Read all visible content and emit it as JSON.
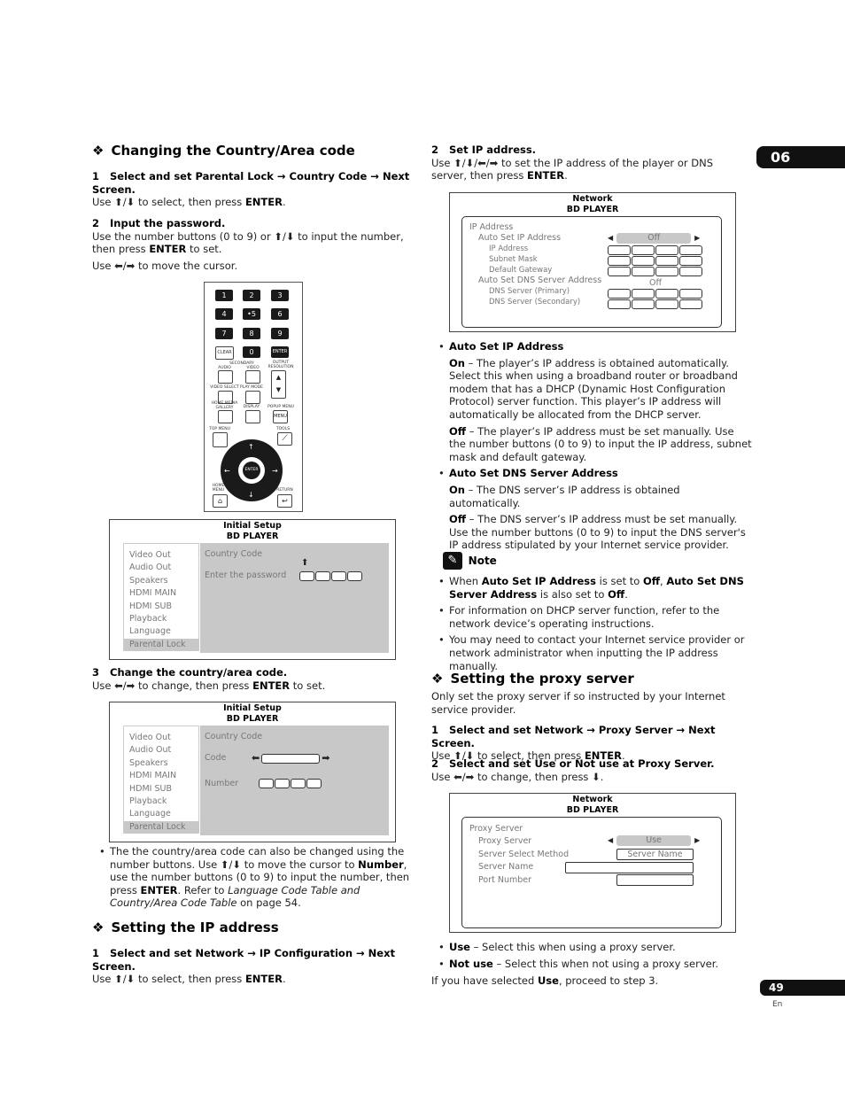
{
  "chapter_tab": "06",
  "page_number": "49",
  "page_lang": "En",
  "left": {
    "country_title": "Changing the Country/Area code",
    "step1_num": "1",
    "step1_title": "Select and set Parental Lock → Country Code → Next Screen.",
    "step1_text_a": "Use ⬆/⬇ to select, then press ",
    "step1_text_b": "ENTER",
    "step2_num": "2",
    "step2_title": "Input the password.",
    "step2_text_a": "Use the number buttons (0 to 9) or ⬆/⬇ to input the number, then press ",
    "step2_text_b": "ENTER",
    " step2_text_c": " to set.",
    "step2_text_d": "Use ⬅/➡ to move the cursor.",
    "step3_num": "3",
    "step3_title": "Change the country/area code.",
    "step3_text_a": "Use ⬅/➡ to change, then press ",
    "step3_text_b": "ENTER",
    "step3_text_c": " to set.",
    "bullet_a": "The the country/area code can also be changed using the number buttons. Use ⬆/⬇ to move the cursor to ",
    "bullet_b": "Number",
    "bullet_c": ", use the number buttons (0 to 9) to input the number, then press ",
    "bullet_d": "ENTER",
    "bullet_e": ". Refer to ",
    "bullet_f": "Language Code Table and Country/Area Code Table",
    "bullet_g": " on page 54.",
    "ip_title": "Setting the IP address",
    "ip_step1_num": "1",
    "ip_step1_title": "Select and set Network → IP Configuration → Next Screen.",
    "ip_step1_text_a": "Use ⬆/⬇ to select, then press ",
    "ip_step1_text_b": "ENTER"
  },
  "remote": {
    "keys": [
      "1",
      "2",
      "3",
      "4",
      "•5",
      "6",
      "7",
      "8",
      "9"
    ],
    "clear": "CLEAR",
    "zero": "0",
    "enter": "ENTER",
    "secondary": "SECONDARY",
    "audio": "AUDIO",
    "video": "VIDEO",
    "output_resolution": "OUTPUT RESOLUTION",
    "video_select": "VIDEO SELECT",
    "play_mode": "PLAY MODE",
    "home_media_gallery": "HOME MEDIA GALLERY",
    "display": "DISPLAY",
    "popup_menu": "POPUP MENU",
    "menu": "MENU",
    "top_menu": "TOP MENU",
    "tools": "TOOLS",
    "home_menu": "HOME MENU",
    "return": "RETURN"
  },
  "screen_setup": {
    "title": "Initial Setup",
    "subtitle": "BD PLAYER",
    "menu": [
      "Video Out",
      "Audio Out",
      "Speakers",
      "HDMI MAIN",
      "HDMI SUB",
      "Playback",
      "Language",
      "Parental Lock"
    ],
    "country_code": "Country Code",
    "enter_password": "Enter the password",
    "code": "Code",
    "number": "Number"
  },
  "screen_network": {
    "title": "Network",
    "subtitle": "BD PLAYER",
    "rows": [
      "IP Address",
      "Auto Set IP Address",
      "IP Address",
      "Subnet Mask",
      "Default Gateway",
      "Auto Set DNS Server Address",
      "DNS Server (Primary)",
      "DNS Server (Secondary)"
    ],
    "auto_ip_value": "Off",
    "auto_dns_value": "Off"
  },
  "right": {
    "step2_num": "2",
    "step2_title": "Set IP address.",
    "step2_text_a": "Use ⬆/⬇/⬅/➡ to set the IP address of the player or DNS server, then press ",
    "step2_text_b": "ENTER",
    "auto_ip_head": "Auto Set IP Address",
    "on_label": "On",
    "auto_ip_on": " – The player’s IP address is obtained automatically. Select this when using a broadband router or broadband modem that has a DHCP (Dynamic Host Configuration Protocol) server function. This player’s IP address will automatically be allocated from the DHCP server.",
    "off_label": "Off",
    "auto_ip_off": " – The player’s IP address must be set manually. Use the number buttons (0 to 9) to input the IP address, subnet mask and default gateway.",
    "auto_dns_head": "Auto Set DNS Server Address",
    "auto_dns_on": " – The DNS server’s IP address is obtained automatically.",
    "auto_dns_off": " – The DNS server’s IP address must be set manually. Use the number buttons (0 to 9) to input the DNS server's IP address stipulated by your Internet service provider.",
    "note_title": "Note",
    "note1_a": "When ",
    "note1_b": "Auto Set IP Address",
    "note1_c": " is set to ",
    "note1_d": "Off",
    "note1_e": ", ",
    "note1_f": "Auto Set DNS Server Address",
    "note1_g": " is also set to ",
    "note1_h": "Off",
    "note1_i": ".",
    "note2": "For information on DHCP server function, refer to the network device’s operating instructions.",
    "note3": "You may need to contact your Internet service provider or network administrator when inputting the IP address manually.",
    "proxy_title": "Setting the proxy server",
    "proxy_intro": "Only set the proxy server if so instructed by your Internet service provider.",
    "p_step1_num": "1",
    "p_step1_title": "Select and set Network → Proxy Server → Next Screen.",
    "p_step1_text_a": "Use ⬆/⬇ to select, then press ",
    "p_step1_text_b": "ENTER",
    "p_step2_num": "2",
    "p_step2_title": "Select and set Use or Not use at Proxy Server.",
    "p_step2_text": "Use ⬅/➡ to change, then press ⬇.",
    "use_label": "Use",
    "use_text": " – Select this when using a proxy server.",
    "notuse_label": "Not use",
    "notuse_text": " – Select this when not using a proxy server.",
    "final_a": "If you have selected ",
    "final_b": "Use",
    "final_c": ", proceed to step 3."
  },
  "screen_proxy": {
    "title": "Network",
    "subtitle": "BD PLAYER",
    "rows": [
      "Proxy Server",
      "Proxy Server",
      "Server Select Method",
      "Server Name",
      "Port Number"
    ],
    "proxy_value": "Use",
    "method_value": "Server Name"
  }
}
